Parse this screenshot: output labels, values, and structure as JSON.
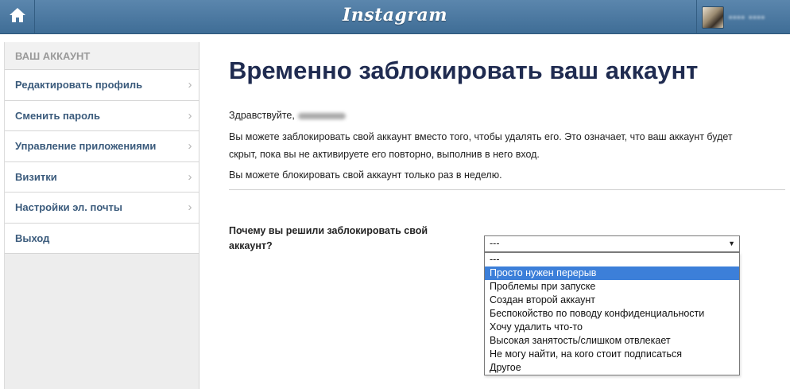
{
  "header": {
    "logo": "Instagram",
    "home_icon": "home-icon",
    "username": "•••• ••••"
  },
  "sidebar": {
    "heading": "ВАШ АККАУНТ",
    "items": [
      {
        "label": "Редактировать профиль"
      },
      {
        "label": "Сменить пароль"
      },
      {
        "label": "Управление приложениями"
      },
      {
        "label": "Визитки"
      },
      {
        "label": "Настройки эл. почты"
      },
      {
        "label": "Выход"
      }
    ]
  },
  "main": {
    "title": "Временно заблокировать ваш аккаунт",
    "greeting": "Здравствуйте,",
    "para1_line1": "Вы можете заблокировать свой аккаунт вместо того, чтобы удалять его. Это означает, что ваш аккаунт будет",
    "para1_line2": "скрыт, пока вы не активируете его повторно, выполнив в него вход.",
    "para2": "Вы можете блокировать свой аккаунт только раз в неделю.",
    "question_line1": "Почему вы решили заблокировать свой",
    "question_line2": "аккаунт?",
    "select": {
      "value": "---",
      "options": [
        {
          "label": "---"
        },
        {
          "label": "Просто нужен перерыв",
          "selected": true
        },
        {
          "label": "Проблемы при запуске"
        },
        {
          "label": "Создан второй аккаунт"
        },
        {
          "label": "Беспокойство по поводу конфиденциальности"
        },
        {
          "label": "Хочу удалить что-то"
        },
        {
          "label": "Высокая занятость/слишком отвлекает"
        },
        {
          "label": "Не могу найти, на кого стоит подписаться"
        },
        {
          "label": "Другое"
        }
      ]
    }
  }
}
